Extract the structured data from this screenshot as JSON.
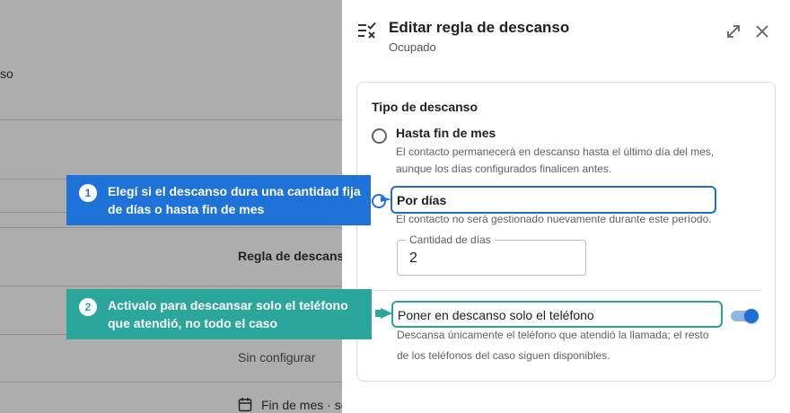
{
  "background": {
    "partial_label": "so",
    "section_title": "Regla de descanso",
    "unconfigured": "Sin configurar",
    "end_of_month": "Fin de mes · so"
  },
  "panel": {
    "icon": "rule-edit-icon",
    "title": "Editar regla de descanso",
    "subtitle": "Ocupado",
    "expand_icon": "expand-icon",
    "close_icon": "close-icon"
  },
  "card": {
    "title": "Tipo de descanso",
    "option_month": {
      "label": "Hasta fin de mes",
      "desc_line1": "El contacto permanecerá en descanso hasta el último día del mes,",
      "desc_line2": "aunque los días configurados finalicen antes."
    },
    "option_days": {
      "label": "Por días",
      "desc": "El contacto no será gestionado nuevamente durante este período."
    },
    "days_field": {
      "label": "Cantidad de días",
      "value": "2"
    },
    "phone_only": {
      "label": "Poner en descanso solo el teléfono",
      "desc_line1": "Descansa únicamente el teléfono que atendió la llamada; el resto",
      "desc_line2": "de los teléfonos del caso siguen disponibles.",
      "enabled": true
    }
  },
  "callouts": [
    {
      "number": "1",
      "text": "Elegí si el descanso dura una cantidad fija de días o hasta fin de mes",
      "color": "#1e72d8"
    },
    {
      "number": "2",
      "text": "Activalo para descansar solo el teléfono que atendió, no todo el caso",
      "color": "#2aa79a"
    }
  ]
}
